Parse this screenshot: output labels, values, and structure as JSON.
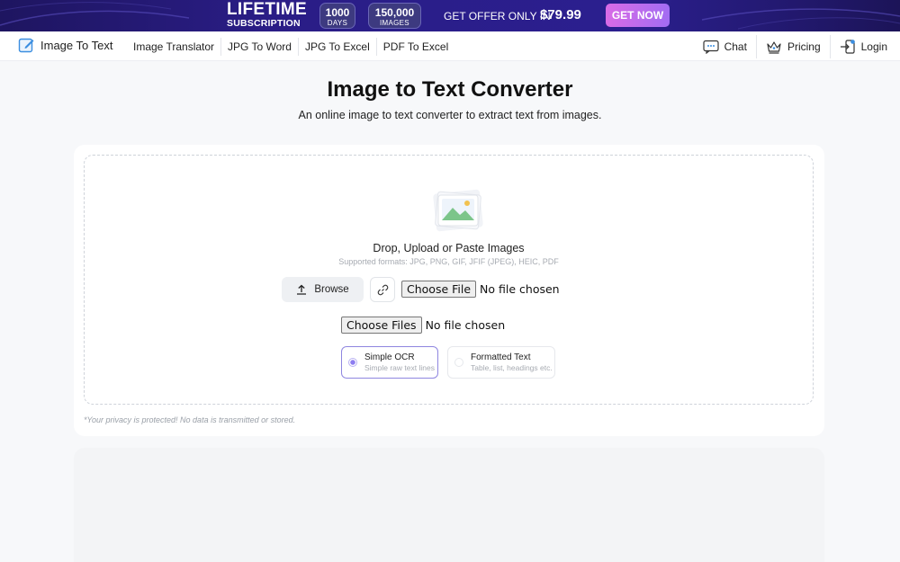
{
  "promo": {
    "lifetime": "LIFETIME",
    "subscription": "SUBSCRIPTION",
    "days_value": "1000",
    "days_unit": "DAYS",
    "images_value": "150,000",
    "images_unit": "IMAGES",
    "offer_text": "GET OFFER ONLY IN",
    "price": "$79.99",
    "cta": "GET NOW"
  },
  "nav": {
    "brand": "Image To Text",
    "links": [
      "Image Translator",
      "JPG To Word",
      "JPG To Excel",
      "PDF To Excel"
    ],
    "chat": "Chat",
    "pricing": "Pricing",
    "login": "Login"
  },
  "header": {
    "title": "Image to Text Converter",
    "subtitle": "An online image to text converter to extract text from images."
  },
  "upload": {
    "title": "Drop, Upload or Paste Images",
    "formats": "Supported formats: JPG, PNG, GIF, JFIF (JPEG), HEIC, PDF",
    "browse": "Browse",
    "file_button": "Choose File",
    "file_status": "No file chosen",
    "files_button": "Choose Files",
    "files_status": "No file chosen"
  },
  "modes": [
    {
      "title": "Simple OCR",
      "desc": "Simple raw text lines",
      "selected": true
    },
    {
      "title": "Formatted Text",
      "desc": "Table, list, headings etc.",
      "selected": false
    }
  ],
  "privacy": "*Your privacy is protected! No data is transmitted or stored.",
  "colors": {
    "banner": "#2a1d86",
    "cta": "#c46cea",
    "accent": "#8d7df0"
  }
}
